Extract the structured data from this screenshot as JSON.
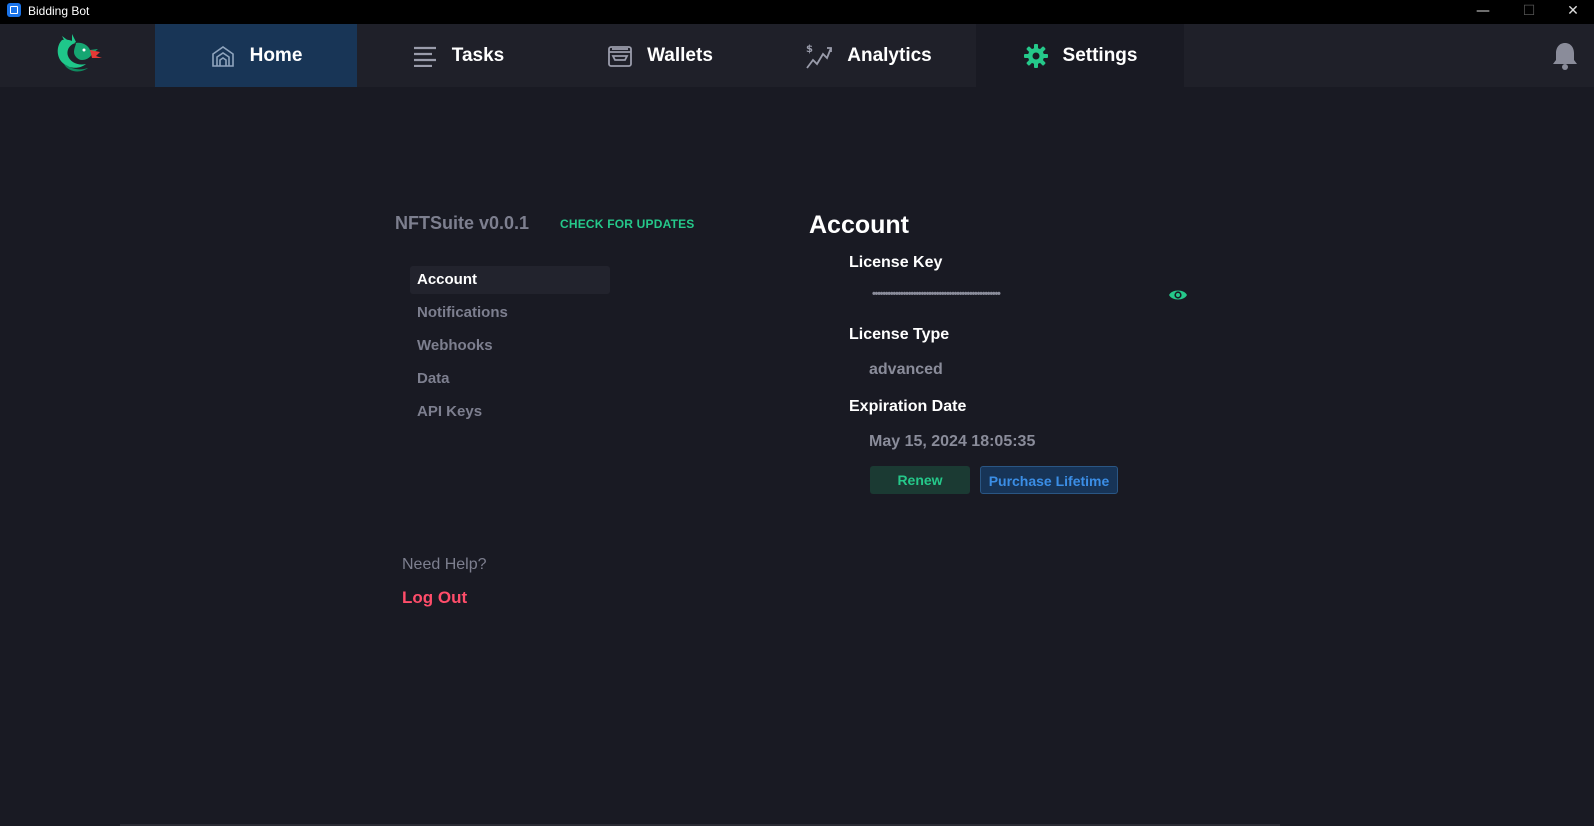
{
  "window": {
    "title": "Bidding Bot",
    "controls": {
      "minimize": "—",
      "maximize": "☐",
      "close": "✕"
    }
  },
  "nav": {
    "tabs": [
      {
        "label": "Home",
        "icon": "home-icon"
      },
      {
        "label": "Tasks",
        "icon": "list-icon"
      },
      {
        "label": "Wallets",
        "icon": "wallet-icon"
      },
      {
        "label": "Analytics",
        "icon": "analytics-icon"
      },
      {
        "label": "Settings",
        "icon": "gear-icon"
      }
    ],
    "active_tab": "Settings"
  },
  "settings": {
    "brand": "NFTSuite v0.0.1",
    "check_updates": "CHECK FOR UPDATES",
    "menu": [
      {
        "label": "Account"
      },
      {
        "label": "Notifications"
      },
      {
        "label": "Webhooks"
      },
      {
        "label": "Data"
      },
      {
        "label": "API Keys"
      }
    ],
    "active_item": "Account",
    "need_help": "Need Help?",
    "logout": "Log Out"
  },
  "account": {
    "title": "Account",
    "license_key_label": "License Key",
    "license_key_masked": "••••••••••••••••••••••••••••••••••••••••••••••••••",
    "license_type_label": "License Type",
    "license_type": "advanced",
    "expiration_label": "Expiration Date",
    "expiration": "May 15, 2024 18:05:35",
    "renew_button": "Renew",
    "lifetime_button": "Purchase Lifetime"
  },
  "colors": {
    "background": "#191a23",
    "navbar": "#1f2029",
    "active_nav": "#183556",
    "accent_green": "#25c88a",
    "accent_blue": "#3b8ee6",
    "logout_red": "#ff4d6a"
  }
}
